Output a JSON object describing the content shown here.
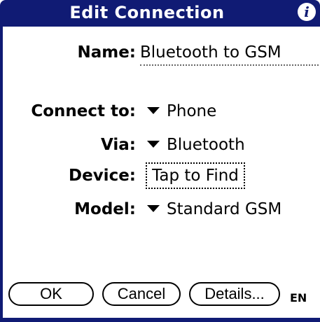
{
  "titlebar": {
    "title": "Edit Connection",
    "info_icon_glyph": "i"
  },
  "form": {
    "name": {
      "label": "Name:",
      "value": "Bluetooth to GSM"
    },
    "connect_to": {
      "label": "Connect to:",
      "value": "Phone"
    },
    "via": {
      "label": "Via:",
      "value": "Bluetooth"
    },
    "device": {
      "label": "Device:",
      "value": "Tap to Find"
    },
    "model": {
      "label": "Model:",
      "value": "Standard GSM"
    }
  },
  "buttons": {
    "ok": "OK",
    "cancel": "Cancel",
    "details": "Details..."
  },
  "status": {
    "language": "EN"
  },
  "colors": {
    "titlebar": "#101b74",
    "background": "#ffffff",
    "text": "#000000"
  }
}
